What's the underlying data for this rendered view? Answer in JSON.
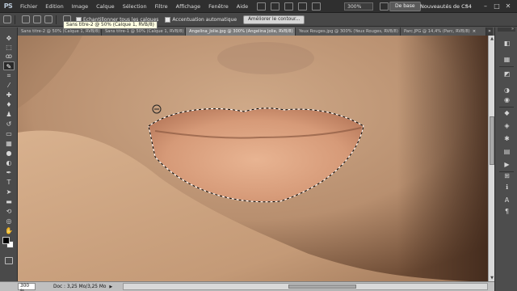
{
  "app": {
    "logo": "PS",
    "menu": [
      "Fichier",
      "Edition",
      "Image",
      "Calque",
      "Sélection",
      "Filtre",
      "Affichage",
      "Fenêtre",
      "Aide"
    ],
    "zoom_select": "300%",
    "workspace_button": "De base",
    "workspace_new": "Nouveautés de CS4",
    "workspace_arrow": "»",
    "window_controls": {
      "minimize": "–",
      "restore": "□",
      "close": "✕"
    }
  },
  "options_bar": {
    "sample_all_layers": "Echantillonner tous les calques",
    "auto_enhance": "Accentuation automatique",
    "refine_edge_button": "Améliorer le contour..."
  },
  "tooltip": "Sans titre-2 @ 50% (Calque 1, RVB/8)",
  "tabs": [
    {
      "label": "Sans titre-2 @ 50% (Calque 1, RVB/8)",
      "close": "×",
      "active": false
    },
    {
      "label": "Sans titre-1 @ 50% (Calque 1, RVB/8)",
      "close": "×",
      "active": false
    },
    {
      "label": "Angelina_Jolie.jpg @ 300% (Angelina Jolie, RVB/8)",
      "close": "×",
      "active": true
    },
    {
      "label": "Yeux Rouges.jpg @ 300% (Yeux Rouges, RVB/8)",
      "close": "×",
      "active": false
    },
    {
      "label": "Parc.JPG @ 14,4% (Parc, RVB/8)",
      "close": "×",
      "active": false
    }
  ],
  "tabs_overflow": "»",
  "tools": [
    {
      "name": "move-tool-icon",
      "glyph": "✥",
      "active": false
    },
    {
      "name": "marquee-tool-icon",
      "glyph": "⬚",
      "active": false
    },
    {
      "name": "lasso-tool-icon",
      "glyph": "ꝏ",
      "active": false
    },
    {
      "name": "quick-selection-tool-icon",
      "glyph": "✎",
      "active": true
    },
    {
      "name": "crop-tool-icon",
      "glyph": "⌗",
      "active": false
    },
    {
      "name": "eyedropper-tool-icon",
      "glyph": "⁄",
      "active": false
    },
    {
      "name": "healing-brush-tool-icon",
      "glyph": "✚",
      "active": false
    },
    {
      "name": "brush-tool-icon",
      "glyph": "♦",
      "active": false
    },
    {
      "name": "clone-stamp-tool-icon",
      "glyph": "♟",
      "active": false
    },
    {
      "name": "history-brush-tool-icon",
      "glyph": "↺",
      "active": false
    },
    {
      "name": "eraser-tool-icon",
      "glyph": "▭",
      "active": false
    },
    {
      "name": "gradient-tool-icon",
      "glyph": "▦",
      "active": false
    },
    {
      "name": "blur-tool-icon",
      "glyph": "●",
      "active": false
    },
    {
      "name": "dodge-tool-icon",
      "glyph": "◐",
      "active": false
    },
    {
      "name": "pen-tool-icon",
      "glyph": "✒",
      "active": false
    },
    {
      "name": "type-tool-icon",
      "glyph": "T",
      "active": false
    },
    {
      "name": "path-selection-tool-icon",
      "glyph": "➤",
      "active": false
    },
    {
      "name": "shape-tool-icon",
      "glyph": "▬",
      "active": false
    },
    {
      "name": "3d-rotate-tool-icon",
      "glyph": "⟲",
      "active": false
    },
    {
      "name": "3d-orbit-tool-icon",
      "glyph": "◎",
      "active": false
    },
    {
      "name": "hand-tool-icon",
      "glyph": "✋",
      "active": false
    },
    {
      "name": "zoom-tool-icon",
      "glyph": "⌕",
      "active": false
    }
  ],
  "dock": [
    {
      "name": "color-panel-icon",
      "glyph": "◧"
    },
    {
      "name": "swatches-panel-icon",
      "glyph": "▦"
    },
    {
      "name": "styles-panel-icon",
      "glyph": "◩"
    },
    {
      "name": "adjustments-panel-icon",
      "glyph": "◑"
    },
    {
      "name": "masks-panel-icon",
      "glyph": "◉"
    },
    {
      "name": "layers-panel-icon",
      "glyph": "◆"
    },
    {
      "name": "channels-panel-icon",
      "glyph": "◈"
    },
    {
      "name": "paths-panel-icon",
      "glyph": "✱"
    },
    {
      "name": "history-panel-icon",
      "glyph": "▤"
    },
    {
      "name": "actions-panel-icon",
      "glyph": "▶"
    },
    {
      "name": "navigator-panel-icon",
      "glyph": "⊞"
    },
    {
      "name": "info-panel-icon",
      "glyph": "ℹ"
    },
    {
      "name": "character-panel-icon",
      "glyph": "A"
    },
    {
      "name": "paragraph-panel-icon",
      "glyph": "¶"
    }
  ],
  "status": {
    "zoom": "300 %",
    "doc_info": "Doc : 3,25 Mo/3,25 Mo",
    "arrow": "▶"
  },
  "colors": {
    "foreground": "#000000",
    "background": "#ffffff",
    "skin": "#c7a282",
    "lips": "#d9a07e"
  }
}
